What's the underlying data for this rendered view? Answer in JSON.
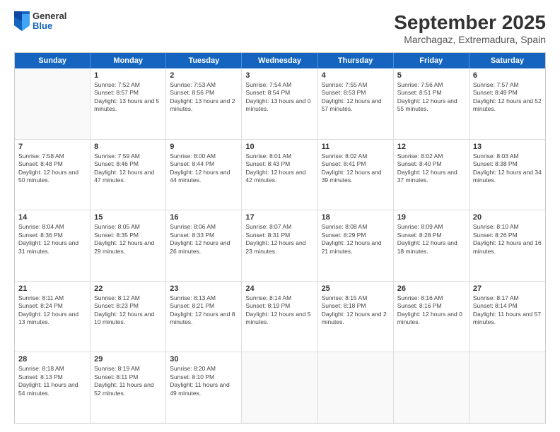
{
  "header": {
    "logo": {
      "general": "General",
      "blue": "Blue"
    },
    "title": "September 2025",
    "location": "Marchagaz, Extremadura, Spain"
  },
  "days_of_week": [
    "Sunday",
    "Monday",
    "Tuesday",
    "Wednesday",
    "Thursday",
    "Friday",
    "Saturday"
  ],
  "weeks": [
    [
      {
        "day": "",
        "empty": true
      },
      {
        "day": "1",
        "sunrise": "Sunrise: 7:52 AM",
        "sunset": "Sunset: 8:57 PM",
        "daylight": "Daylight: 13 hours and 5 minutes."
      },
      {
        "day": "2",
        "sunrise": "Sunrise: 7:53 AM",
        "sunset": "Sunset: 8:56 PM",
        "daylight": "Daylight: 13 hours and 2 minutes."
      },
      {
        "day": "3",
        "sunrise": "Sunrise: 7:54 AM",
        "sunset": "Sunset: 8:54 PM",
        "daylight": "Daylight: 13 hours and 0 minutes."
      },
      {
        "day": "4",
        "sunrise": "Sunrise: 7:55 AM",
        "sunset": "Sunset: 8:53 PM",
        "daylight": "Daylight: 12 hours and 57 minutes."
      },
      {
        "day": "5",
        "sunrise": "Sunrise: 7:56 AM",
        "sunset": "Sunset: 8:51 PM",
        "daylight": "Daylight: 12 hours and 55 minutes."
      },
      {
        "day": "6",
        "sunrise": "Sunrise: 7:57 AM",
        "sunset": "Sunset: 8:49 PM",
        "daylight": "Daylight: 12 hours and 52 minutes."
      }
    ],
    [
      {
        "day": "7",
        "sunrise": "Sunrise: 7:58 AM",
        "sunset": "Sunset: 8:48 PM",
        "daylight": "Daylight: 12 hours and 50 minutes."
      },
      {
        "day": "8",
        "sunrise": "Sunrise: 7:59 AM",
        "sunset": "Sunset: 8:46 PM",
        "daylight": "Daylight: 12 hours and 47 minutes."
      },
      {
        "day": "9",
        "sunrise": "Sunrise: 8:00 AM",
        "sunset": "Sunset: 8:44 PM",
        "daylight": "Daylight: 12 hours and 44 minutes."
      },
      {
        "day": "10",
        "sunrise": "Sunrise: 8:01 AM",
        "sunset": "Sunset: 8:43 PM",
        "daylight": "Daylight: 12 hours and 42 minutes."
      },
      {
        "day": "11",
        "sunrise": "Sunrise: 8:02 AM",
        "sunset": "Sunset: 8:41 PM",
        "daylight": "Daylight: 12 hours and 39 minutes."
      },
      {
        "day": "12",
        "sunrise": "Sunrise: 8:02 AM",
        "sunset": "Sunset: 8:40 PM",
        "daylight": "Daylight: 12 hours and 37 minutes."
      },
      {
        "day": "13",
        "sunrise": "Sunrise: 8:03 AM",
        "sunset": "Sunset: 8:38 PM",
        "daylight": "Daylight: 12 hours and 34 minutes."
      }
    ],
    [
      {
        "day": "14",
        "sunrise": "Sunrise: 8:04 AM",
        "sunset": "Sunset: 8:36 PM",
        "daylight": "Daylight: 12 hours and 31 minutes."
      },
      {
        "day": "15",
        "sunrise": "Sunrise: 8:05 AM",
        "sunset": "Sunset: 8:35 PM",
        "daylight": "Daylight: 12 hours and 29 minutes."
      },
      {
        "day": "16",
        "sunrise": "Sunrise: 8:06 AM",
        "sunset": "Sunset: 8:33 PM",
        "daylight": "Daylight: 12 hours and 26 minutes."
      },
      {
        "day": "17",
        "sunrise": "Sunrise: 8:07 AM",
        "sunset": "Sunset: 8:31 PM",
        "daylight": "Daylight: 12 hours and 23 minutes."
      },
      {
        "day": "18",
        "sunrise": "Sunrise: 8:08 AM",
        "sunset": "Sunset: 8:29 PM",
        "daylight": "Daylight: 12 hours and 21 minutes."
      },
      {
        "day": "19",
        "sunrise": "Sunrise: 8:09 AM",
        "sunset": "Sunset: 8:28 PM",
        "daylight": "Daylight: 12 hours and 18 minutes."
      },
      {
        "day": "20",
        "sunrise": "Sunrise: 8:10 AM",
        "sunset": "Sunset: 8:26 PM",
        "daylight": "Daylight: 12 hours and 16 minutes."
      }
    ],
    [
      {
        "day": "21",
        "sunrise": "Sunrise: 8:11 AM",
        "sunset": "Sunset: 8:24 PM",
        "daylight": "Daylight: 12 hours and 13 minutes."
      },
      {
        "day": "22",
        "sunrise": "Sunrise: 8:12 AM",
        "sunset": "Sunset: 8:23 PM",
        "daylight": "Daylight: 12 hours and 10 minutes."
      },
      {
        "day": "23",
        "sunrise": "Sunrise: 8:13 AM",
        "sunset": "Sunset: 8:21 PM",
        "daylight": "Daylight: 12 hours and 8 minutes."
      },
      {
        "day": "24",
        "sunrise": "Sunrise: 8:14 AM",
        "sunset": "Sunset: 8:19 PM",
        "daylight": "Daylight: 12 hours and 5 minutes."
      },
      {
        "day": "25",
        "sunrise": "Sunrise: 8:15 AM",
        "sunset": "Sunset: 8:18 PM",
        "daylight": "Daylight: 12 hours and 2 minutes."
      },
      {
        "day": "26",
        "sunrise": "Sunrise: 8:16 AM",
        "sunset": "Sunset: 8:16 PM",
        "daylight": "Daylight: 12 hours and 0 minutes."
      },
      {
        "day": "27",
        "sunrise": "Sunrise: 8:17 AM",
        "sunset": "Sunset: 8:14 PM",
        "daylight": "Daylight: 11 hours and 57 minutes."
      }
    ],
    [
      {
        "day": "28",
        "sunrise": "Sunrise: 8:18 AM",
        "sunset": "Sunset: 8:13 PM",
        "daylight": "Daylight: 11 hours and 54 minutes."
      },
      {
        "day": "29",
        "sunrise": "Sunrise: 8:19 AM",
        "sunset": "Sunset: 8:11 PM",
        "daylight": "Daylight: 11 hours and 52 minutes."
      },
      {
        "day": "30",
        "sunrise": "Sunrise: 8:20 AM",
        "sunset": "Sunset: 8:10 PM",
        "daylight": "Daylight: 11 hours and 49 minutes."
      },
      {
        "day": "",
        "empty": true
      },
      {
        "day": "",
        "empty": true
      },
      {
        "day": "",
        "empty": true
      },
      {
        "day": "",
        "empty": true
      }
    ]
  ]
}
